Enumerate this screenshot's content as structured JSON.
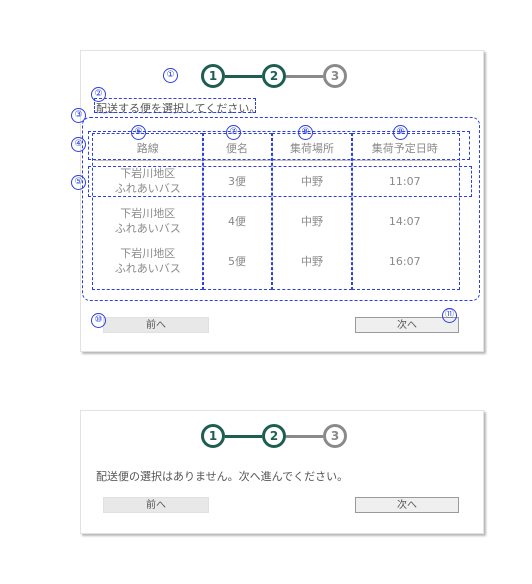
{
  "screens": [
    {
      "steps": [
        "1",
        "2",
        "3"
      ],
      "message": "配送する便を選択してください。",
      "table": {
        "headers": [
          "路線",
          "便名",
          "集荷場所",
          "集荷予定日時"
        ],
        "rows": [
          {
            "route_line1": "下岩川地区",
            "route_line2": "ふれあいバス",
            "bin": "3便",
            "place": "中野",
            "time": "11:07"
          },
          {
            "route_line1": "下岩川地区",
            "route_line2": "ふれあいバス",
            "bin": "4便",
            "place": "中野",
            "time": "14:07"
          },
          {
            "route_line1": "下岩川地区",
            "route_line2": "ふれあいバス",
            "bin": "5便",
            "place": "中野",
            "time": "16:07"
          }
        ]
      },
      "prev_button": "前へ",
      "next_button": "次へ"
    },
    {
      "steps": [
        "1",
        "2",
        "3"
      ],
      "message": "配送便の選択はありません。次へ進んでください。",
      "prev_button": "前へ",
      "next_button": "次へ"
    }
  ],
  "annotations": [
    "①",
    "②",
    "③",
    "④",
    "⑤",
    "⑥",
    "⑦",
    "⑧",
    "⑨",
    "⑩",
    "⑪"
  ],
  "colors": {
    "step_active": "#1e5e52",
    "step_inactive": "#8a8a8a",
    "annotation": "#2c3fe0"
  }
}
